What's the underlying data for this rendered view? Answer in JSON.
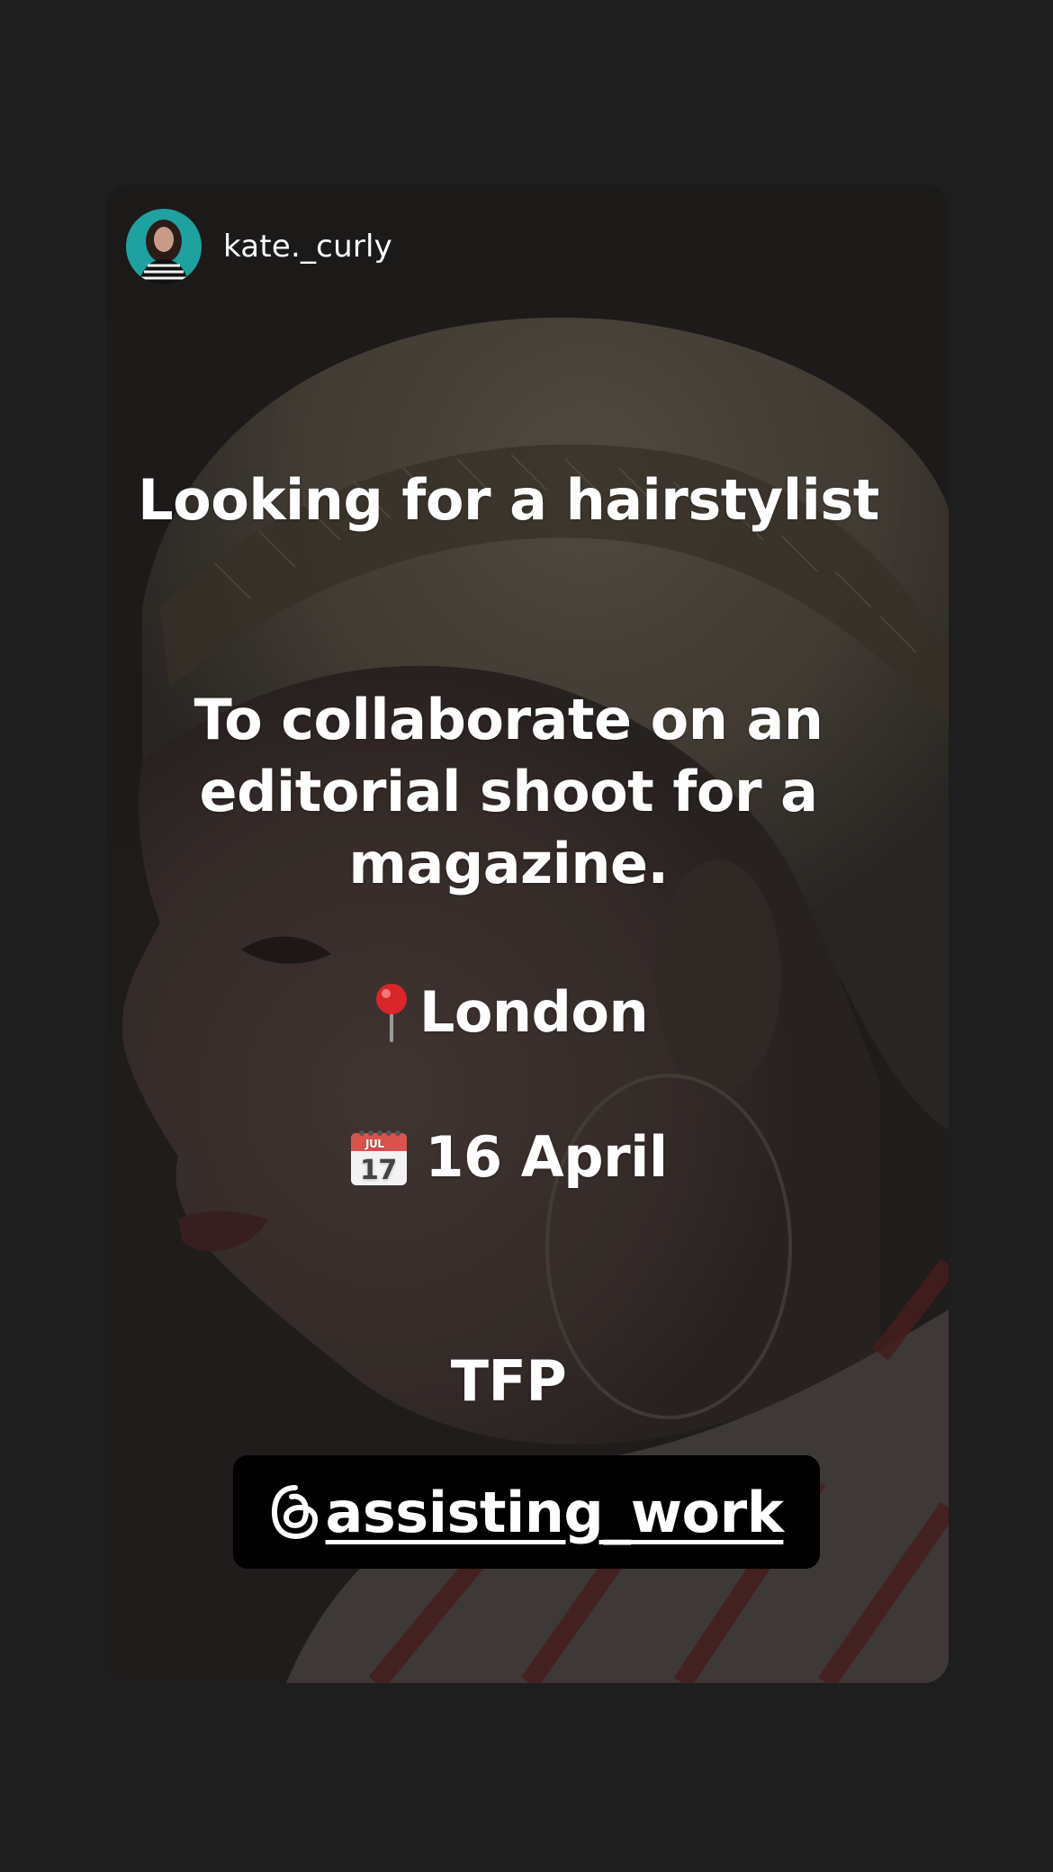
{
  "story": {
    "author": {
      "username": "kate._curly",
      "avatar": "profile-photo"
    },
    "background": "hairstyle-portrait-photo",
    "title": "Looking for a hairstylist",
    "body": "To collaborate on an editorial shoot for a magazine.",
    "location": {
      "icon": "round-pushpin-icon",
      "label": "London"
    },
    "date": {
      "icon": "calendar-icon",
      "icon_month": "JUL",
      "icon_day": "17",
      "label": "16 April"
    },
    "terms": "TFP",
    "mention": {
      "icon": "threads-icon",
      "handle": "assisting_work"
    }
  },
  "colors": {
    "page_background": "#1e1e1e",
    "text": "#ffffff",
    "mention_background": "#000000",
    "avatar_ring": "#1fa1a0"
  }
}
